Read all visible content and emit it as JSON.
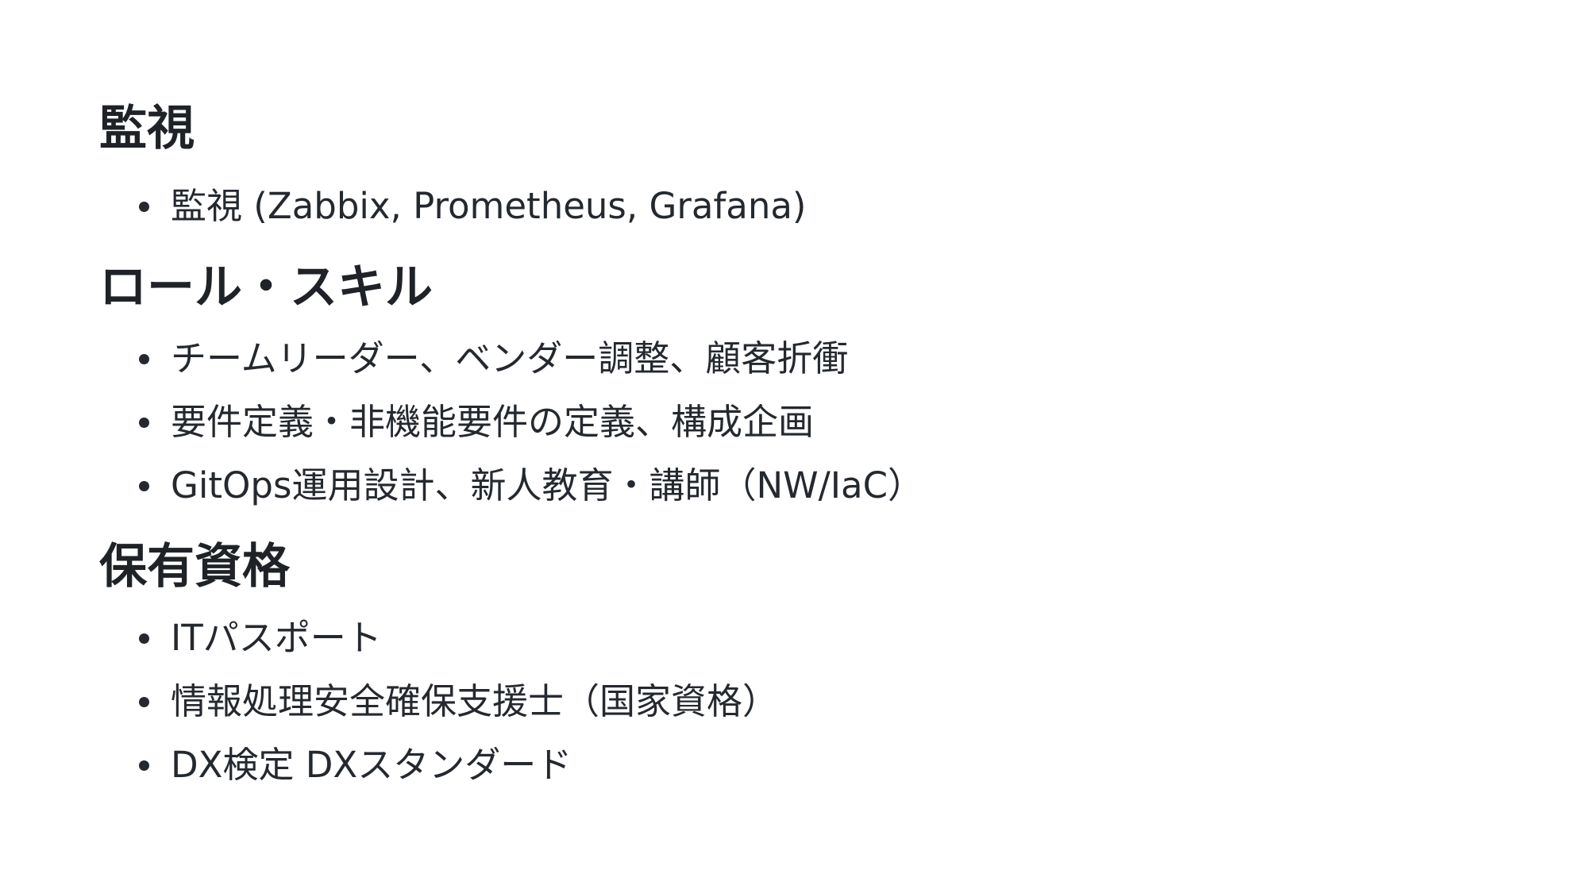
{
  "sections": [
    {
      "heading": "監視",
      "items": [
        "監視 (Zabbix, Prometheus, Grafana)"
      ]
    },
    {
      "heading": "ロール・スキル",
      "items": [
        "チームリーダー、ベンダー調整、顧客折衝",
        "要件定義・非機能要件の定義、構成企画",
        "GitOps運用設計、新人教育・講師（NW/IaC）"
      ]
    },
    {
      "heading": "保有資格",
      "items": [
        "ITパスポート",
        "情報処理安全確保支援士（国家資格）",
        "DX検定 DXスタンダード"
      ]
    }
  ]
}
